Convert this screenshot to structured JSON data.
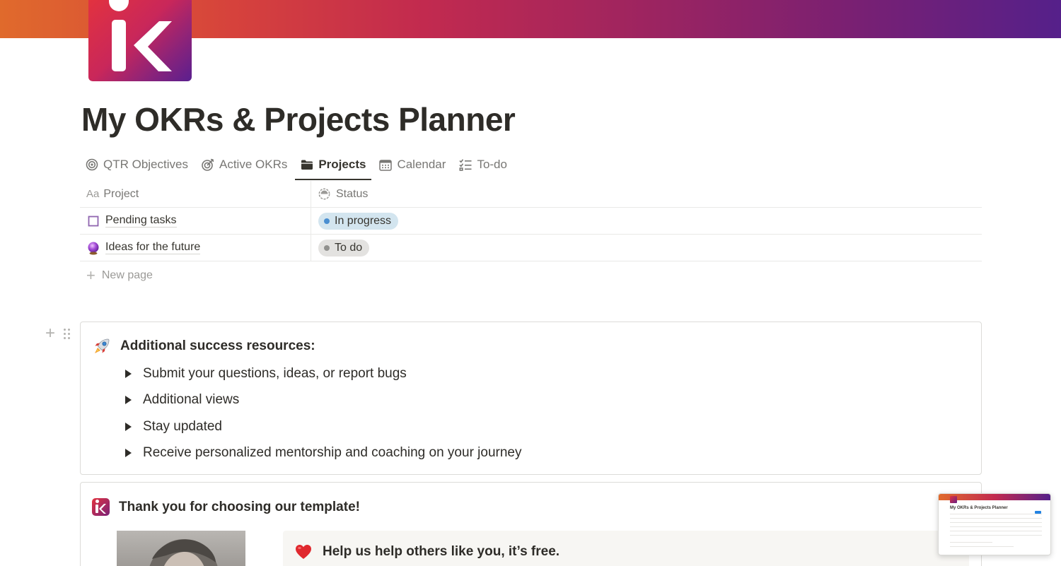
{
  "page": {
    "title": "My OKRs & Projects Planner"
  },
  "brand": {
    "cover_colors": [
      "#e06a2c",
      "#c22a4f",
      "#55208a"
    ],
    "logo_letter": "K"
  },
  "tabs": [
    {
      "label": "QTR Objectives",
      "icon": "target-icon",
      "active": false
    },
    {
      "label": "Active OKRs",
      "icon": "dartboard-icon",
      "active": false
    },
    {
      "label": "Projects",
      "icon": "folder-icon",
      "active": true
    },
    {
      "label": "Calendar",
      "icon": "calendar-icon",
      "active": false
    },
    {
      "label": "To-do",
      "icon": "checklist-icon",
      "active": false
    }
  ],
  "table": {
    "columns": [
      {
        "label": "Project",
        "icon_text": "Aa"
      },
      {
        "label": "Status",
        "icon": "status-icon"
      }
    ],
    "rows": [
      {
        "name": "Pending tasks",
        "icon": "checkbox-icon",
        "status": "In progress",
        "status_bg": "#d3e5ef",
        "status_dot": "#4a8fd1"
      },
      {
        "name": "Ideas for the future",
        "icon": "crystal-ball-icon",
        "status": "To do",
        "status_bg": "#e3e2e0",
        "status_dot": "#91918e"
      }
    ],
    "new_page_label": "New page"
  },
  "resources": {
    "icon": "rocket-icon",
    "heading": "Additional success resources:",
    "items": [
      "Submit your questions, ideas, or report bugs",
      "Additional views",
      "Stay updated",
      "Receive personalized mentorship and coaching on your journey"
    ]
  },
  "thanks": {
    "heading": "Thank you for choosing our template!",
    "help_icon": "heart-icon",
    "help_text": "Help us help others like you, it’s free."
  },
  "thumbnail": {
    "title": "My OKRs & Projects Planner"
  }
}
